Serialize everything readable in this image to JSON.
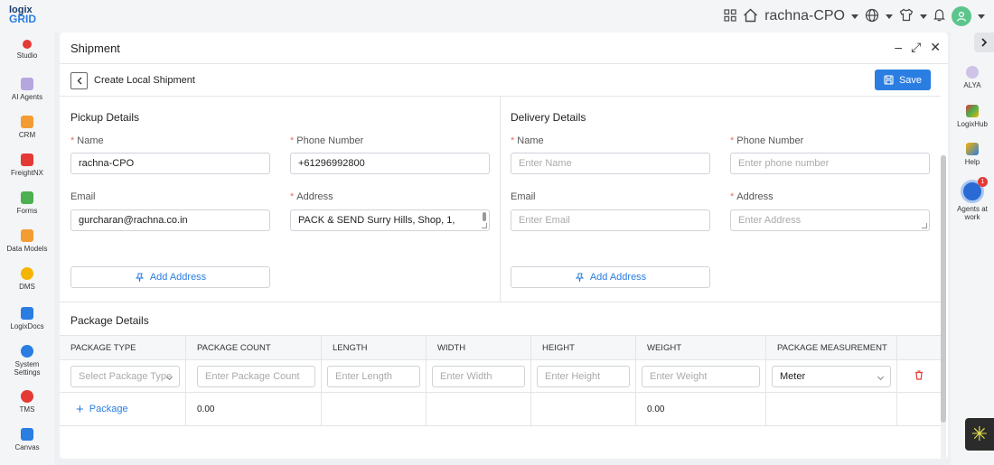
{
  "app": {
    "logo_line1": "logix",
    "logo_line2": "GRID",
    "account_name": "rachna-CPO"
  },
  "left_rail": [
    {
      "label": "Studio",
      "color": "#e53935"
    },
    {
      "label": "AI Agents",
      "color": "#8e7cc3"
    },
    {
      "label": "CRM",
      "color": "#f39c34"
    },
    {
      "label": "FreightNX",
      "color": "#e53935"
    },
    {
      "label": "Forms",
      "color": "#4caf50"
    },
    {
      "label": "Data Models",
      "color": "#f39c34"
    },
    {
      "label": "DMS",
      "color": "#f5b400"
    },
    {
      "label": "LogixDocs",
      "color": "#2a7de1"
    },
    {
      "label": "System Settings",
      "color": "#2a7de1"
    },
    {
      "label": "TMS",
      "color": "#e53935"
    },
    {
      "label": "Canvas",
      "color": "#2a7de1"
    }
  ],
  "right_rail": [
    {
      "label": "ALYA"
    },
    {
      "label": "LogixHub"
    },
    {
      "label": "Help"
    },
    {
      "label": "Agents at work",
      "badge": "1"
    }
  ],
  "panel": {
    "title": "Shipment",
    "subtitle": "Create Local Shipment",
    "save_label": "Save"
  },
  "pickup": {
    "title": "Pickup Details",
    "name_label": "Name",
    "name_value": "rachna-CPO",
    "phone_label": "Phone Number",
    "phone_value": "+61296992800",
    "email_label": "Email",
    "email_value": "gurcharan@rachna.co.in",
    "address_label": "Address",
    "address_value": "PACK & SEND Surry Hills, Shop, 1,",
    "add_address_label": "Add Address"
  },
  "delivery": {
    "title": "Delivery Details",
    "name_label": "Name",
    "name_placeholder": "Enter Name",
    "phone_label": "Phone Number",
    "phone_placeholder": "Enter phone number",
    "email_label": "Email",
    "email_placeholder": "Enter Email",
    "address_label": "Address",
    "address_placeholder": "Enter Address",
    "add_address_label": "Add Address"
  },
  "package": {
    "title": "Package Details",
    "columns": [
      "Package Type",
      "Package Count",
      "Length",
      "Width",
      "Height",
      "Weight",
      "Package Measurement"
    ],
    "row": {
      "type_placeholder": "Select Package Type",
      "count_placeholder": "Enter Package Count",
      "length_placeholder": "Enter Length",
      "width_placeholder": "Enter Width",
      "height_placeholder": "Enter Height",
      "weight_placeholder": "Enter Weight",
      "measurement_value": "Meter"
    },
    "add_package_label": "Package",
    "total_count": "0.00",
    "total_weight": "0.00"
  },
  "colors": {
    "accent": "#2a7de1",
    "required": "#e57373",
    "delete": "#e53935"
  }
}
